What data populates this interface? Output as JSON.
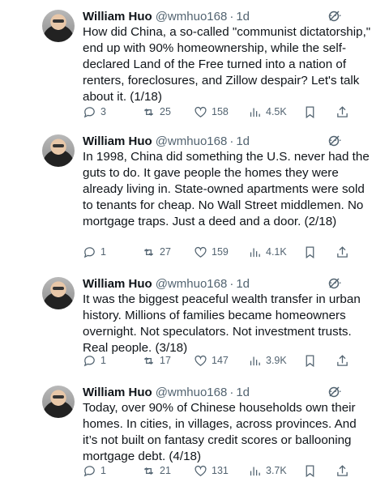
{
  "tweets": [
    {
      "author_name": "William Huo",
      "handle": "@wmhuo168",
      "separator": "·",
      "time": "1d",
      "text": "How did China, a so-called \"communist dictatorship,\" end up with 90% homeownership, while the self-declared Land of the Free turned into a nation of renters, foreclosures, and Zillow despair? Let's talk about it. (1/18)",
      "replies": "3",
      "retweets": "25",
      "likes": "158",
      "views": "4.5K"
    },
    {
      "author_name": "William Huo",
      "handle": "@wmhuo168",
      "separator": "·",
      "time": "1d",
      "text": "In 1998, China did something the U.S. never had the guts to do. It gave people the homes they were already living in. State-owned apartments were sold to tenants for cheap. No Wall Street middlemen. No mortgage traps. Just a deed and a door. (2/18)",
      "replies": "1",
      "retweets": "27",
      "likes": "159",
      "views": "4.1K"
    },
    {
      "author_name": "William Huo",
      "handle": "@wmhuo168",
      "separator": "·",
      "time": "1d",
      "text": "It was the biggest peaceful wealth transfer in urban history. Millions of families became homeowners overnight. Not speculators. Not investment trusts. Real people. (3/18)",
      "replies": "1",
      "retweets": "17",
      "likes": "147",
      "views": "3.9K"
    },
    {
      "author_name": "William Huo",
      "handle": "@wmhuo168",
      "separator": "·",
      "time": "1d",
      "text": "Today, over 90% of Chinese households own their homes. In cities, in villages, across provinces. And it’s not built on fantasy credit scores or ballooning mortgage debt. (4/18)",
      "replies": "1",
      "retweets": "21",
      "likes": "131",
      "views": "3.7K"
    }
  ],
  "icons": {
    "reply": "reply-icon",
    "retweet": "retweet-icon",
    "like": "like-icon",
    "views": "views-icon",
    "bookmark": "bookmark-icon",
    "share": "share-icon",
    "grok": "grok-icon",
    "more": "more-icon"
  },
  "colors": {
    "text": "#0f1419",
    "secondary": "#536471"
  }
}
